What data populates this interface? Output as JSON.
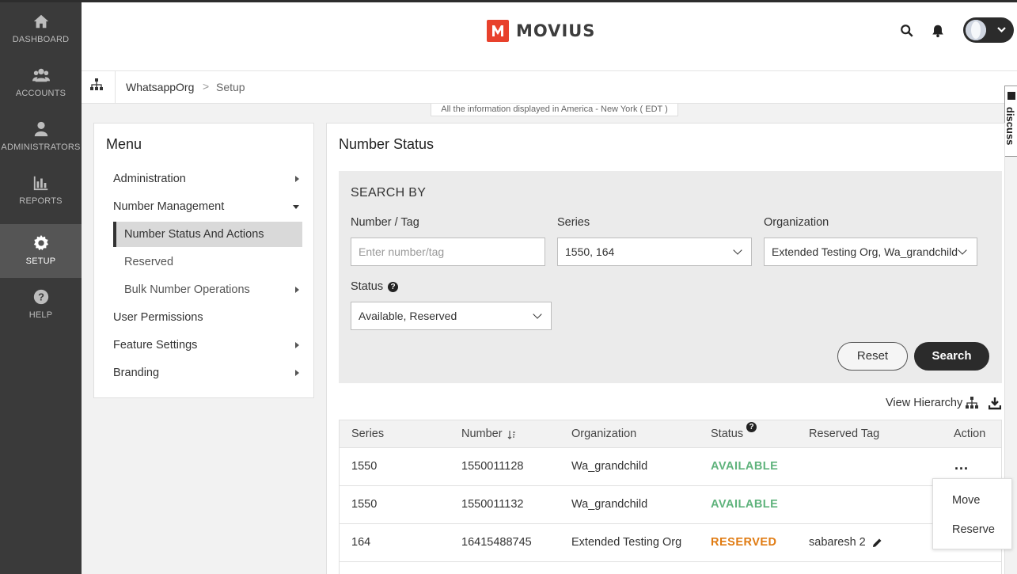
{
  "sidebar": {
    "items": [
      {
        "label": "DASHBOARD",
        "icon": "home-icon"
      },
      {
        "label": "ACCOUNTS",
        "icon": "users-icon"
      },
      {
        "label": "ADMINISTRATORS",
        "icon": "admin-icon"
      },
      {
        "label": "REPORTS",
        "icon": "bar-chart-icon"
      },
      {
        "label": "SETUP",
        "icon": "gear-icon",
        "active": true
      },
      {
        "label": "HELP",
        "icon": "question-icon"
      }
    ]
  },
  "header": {
    "brand": "MOVIUS",
    "brand_color": "#e8412c"
  },
  "breadcrumb": {
    "org": "WhatsappOrg",
    "separator": ">",
    "page": "Setup"
  },
  "timezone_notice": "All the information displayed in America - New York ( EDT )",
  "discuss_tab": "discuss",
  "menu": {
    "title": "Menu",
    "items": [
      {
        "label": "Administration"
      },
      {
        "label": "Number Management"
      },
      {
        "label": "Number Status And Actions"
      },
      {
        "label": "Reserved"
      },
      {
        "label": "Bulk Number Operations"
      },
      {
        "label": "User Permissions"
      },
      {
        "label": "Feature Settings"
      },
      {
        "label": "Branding"
      }
    ]
  },
  "main": {
    "title": "Number Status",
    "search": {
      "heading": "SEARCH BY",
      "number_label": "Number / Tag",
      "number_placeholder": "Enter number/tag",
      "series_label": "Series",
      "series_value": "1550, 164",
      "org_label": "Organization",
      "org_value": "Extended Testing Org, Wa_grandchild",
      "status_label": "Status",
      "status_value": "Available, Reserved",
      "reset": "Reset",
      "search": "Search"
    },
    "view_hierarchy": "View Hierarchy",
    "table": {
      "headers": [
        "Series",
        "Number",
        "Organization",
        "Status",
        "Reserved Tag",
        "Action"
      ],
      "rows": [
        {
          "series": "1550",
          "number": "1550011128",
          "org": "Wa_grandchild",
          "status": "AVAILABLE",
          "tag": ""
        },
        {
          "series": "1550",
          "number": "1550011132",
          "org": "Wa_grandchild",
          "status": "AVAILABLE",
          "tag": ""
        },
        {
          "series": "164",
          "number": "16415488745",
          "org": "Extended Testing Org",
          "status": "RESERVED",
          "tag": "sabaresh 2"
        }
      ]
    },
    "action_menu": [
      "Move",
      "Reserve"
    ]
  },
  "colors": {
    "available": "#5fb37c",
    "reserved": "#e07b12",
    "sidebar_bg": "#3a3a3a"
  }
}
